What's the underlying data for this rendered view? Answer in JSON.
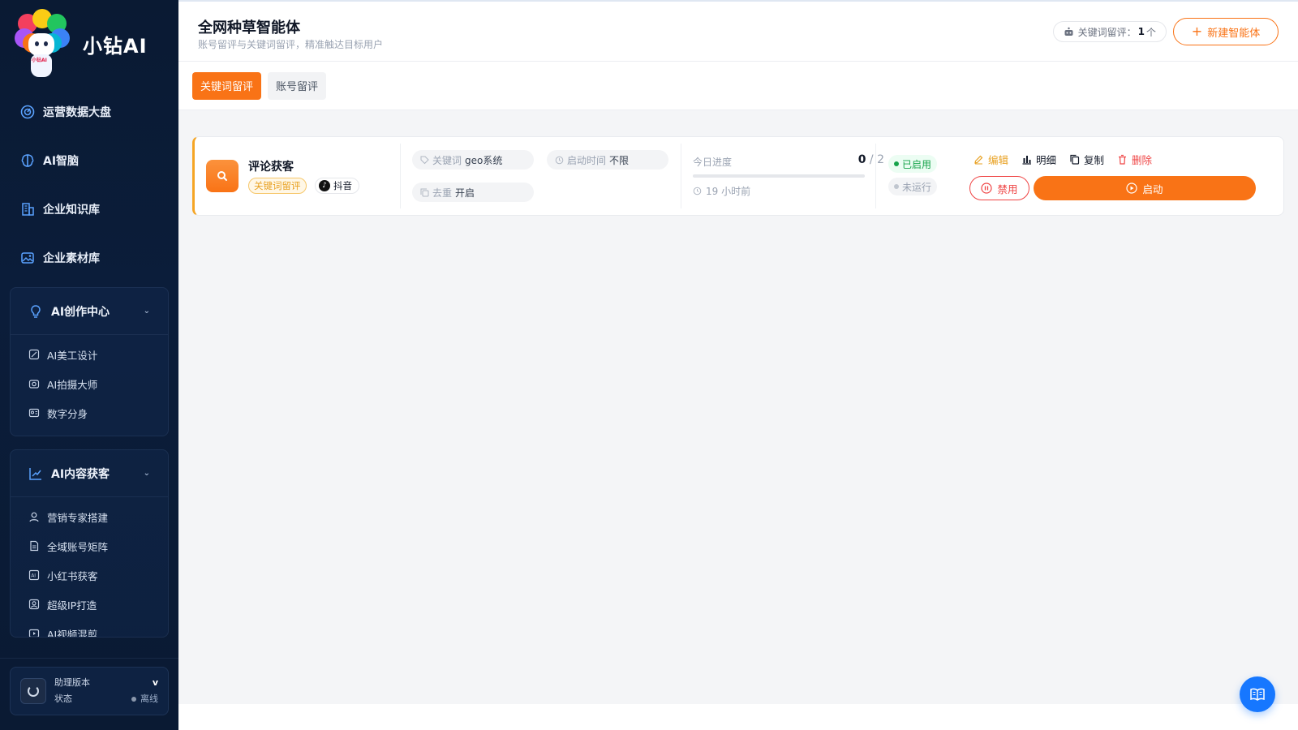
{
  "brand": {
    "name": "小钻AI",
    "logo_badge": "小钻AI"
  },
  "sidebar": {
    "items": [
      {
        "label": "运营数据大盘",
        "icon": "dashboard-icon"
      },
      {
        "label": "AI智脑",
        "icon": "brain-icon"
      },
      {
        "label": "企业知识库",
        "icon": "building-icon"
      },
      {
        "label": "企业素材库",
        "icon": "image-icon"
      }
    ],
    "groups": [
      {
        "label": "AI创作中心",
        "icon": "bulb-icon",
        "items": [
          {
            "label": "AI美工设计",
            "icon": "design-icon"
          },
          {
            "label": "AI拍摄大师",
            "icon": "camera-icon"
          },
          {
            "label": "数字分身",
            "icon": "avatar-card-icon"
          }
        ]
      },
      {
        "label": "AI内容获客",
        "icon": "trend-icon",
        "items": [
          {
            "label": "营销专家搭建",
            "icon": "user-icon"
          },
          {
            "label": "全域账号矩阵",
            "icon": "doc-icon"
          },
          {
            "label": "小红书获客",
            "icon": "ai-icon"
          },
          {
            "label": "超级IP打造",
            "icon": "person-frame-icon"
          },
          {
            "label": "AI视频混剪",
            "icon": "video-icon"
          }
        ]
      }
    ],
    "footer": {
      "version_label": "助理版本",
      "version_value": "v",
      "status_label": "状态",
      "status_value": "离线"
    }
  },
  "header": {
    "title": "全网种草智能体",
    "subtitle": "账号留评与关键词留评，精准触达目标用户",
    "stat_label": "关键词留评：",
    "stat_count": "1",
    "stat_unit": "个",
    "new_button": "新建智能体"
  },
  "tabs": [
    {
      "label": "关键词留评",
      "active": true
    },
    {
      "label": "账号留评",
      "active": false
    }
  ],
  "card": {
    "name": "评论获客",
    "type_tag": "关键词留评",
    "platform": "抖音",
    "keyword_label": "关键词",
    "keyword_value": "geo系统",
    "start_time_label": "启动时间",
    "start_time_value": "不限",
    "dedup_label": "去重",
    "dedup_value": "开启",
    "progress_label": "今日进度",
    "progress_done": "0",
    "progress_sep": " / ",
    "progress_total": "2",
    "progress_fraction": 0,
    "last_time": "19 小时前",
    "status_enabled": "已启用",
    "status_run": "未运行",
    "actions": {
      "edit": "编辑",
      "detail": "明细",
      "copy": "复制",
      "delete": "删除"
    },
    "disable_button": "禁用",
    "start_button": "启动"
  },
  "colors": {
    "accent": "#f97316",
    "danger": "#ef4444",
    "success": "#16a34a",
    "sidebar_bg": "#0a1a33",
    "fab": "#1677ff"
  }
}
